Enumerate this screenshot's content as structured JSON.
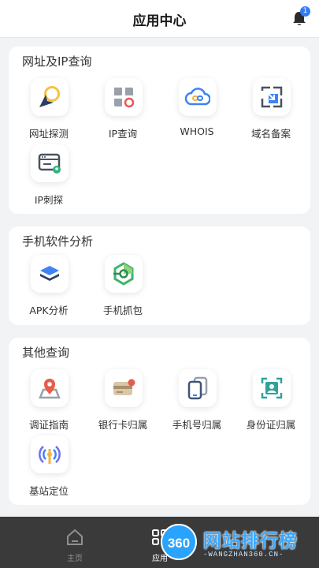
{
  "header": {
    "title": "应用中心",
    "notification_count": "1"
  },
  "sections": [
    {
      "title": "网址及IP查询",
      "items": [
        {
          "label": "网址探测",
          "icon": "location-arrow-icon"
        },
        {
          "label": "IP查询",
          "icon": "ip-grid-icon"
        },
        {
          "label": "WHOIS",
          "icon": "cloud-link-icon"
        },
        {
          "label": "域名备案",
          "icon": "domain-filing-icon"
        },
        {
          "label": "IP刺探",
          "icon": "server-probe-icon"
        }
      ]
    },
    {
      "title": "手机软件分析",
      "items": [
        {
          "label": "APK分析",
          "icon": "layers-icon"
        },
        {
          "label": "手机抓包",
          "icon": "hexagon-capture-icon"
        }
      ]
    },
    {
      "title": "其他查询",
      "items": [
        {
          "label": "调证指南",
          "icon": "map-pin-icon"
        },
        {
          "label": "银行卡归属",
          "icon": "bank-card-icon"
        },
        {
          "label": "手机号归属",
          "icon": "phone-cards-icon"
        },
        {
          "label": "身份证归属",
          "icon": "id-scan-icon"
        },
        {
          "label": "基站定位",
          "icon": "signal-tower-icon"
        }
      ]
    }
  ],
  "tabbar": {
    "items": [
      {
        "label": "主页",
        "icon": "home-icon"
      },
      {
        "label": "应用",
        "icon": "apps-icon"
      }
    ]
  },
  "watermark": {
    "badge": "360",
    "title": "网站排行榜",
    "subtitle": "-WANGZHAN360.CN-"
  },
  "colors": {
    "accent": "#2f7dfb",
    "background": "#f2f3f5",
    "tabbar": "#3a3a3a"
  }
}
